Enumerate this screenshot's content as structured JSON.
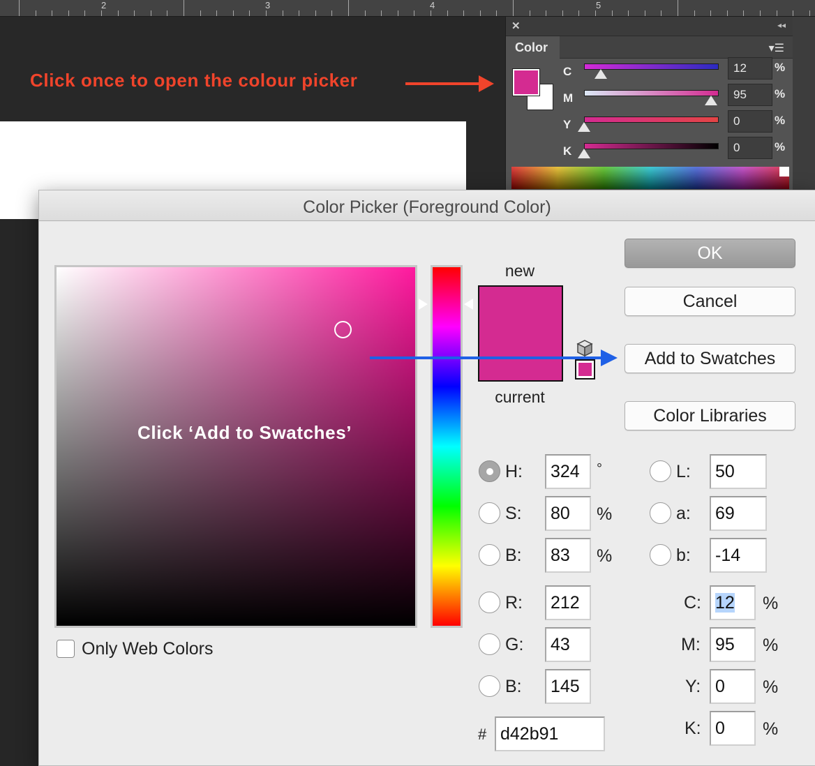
{
  "ruler": {
    "numbers": [
      "2",
      "3",
      "4",
      "5"
    ]
  },
  "annotations": {
    "top": "Click once to open the colour picker",
    "mid": "Click ‘Add to Swatches’"
  },
  "colors": {
    "foreground": "#d42b91",
    "annotation_red": "#f0442b",
    "annotation_blue": "#1f60e6"
  },
  "color_panel": {
    "close_icon": "close-icon",
    "collapse_icon": "double-chevron-left-icon",
    "tab_label": "Color",
    "menu_icon": "panel-menu-icon",
    "sliders": [
      {
        "letter": "C",
        "value": "12",
        "unit": "%"
      },
      {
        "letter": "M",
        "value": "95",
        "unit": "%"
      },
      {
        "letter": "Y",
        "value": "0",
        "unit": "%"
      },
      {
        "letter": "K",
        "value": "0",
        "unit": "%"
      }
    ]
  },
  "dialog": {
    "title": "Color Picker (Foreground Color)",
    "new_label": "new",
    "current_label": "current",
    "buttons": {
      "ok": "OK",
      "cancel": "Cancel",
      "add_to_swatches": "Add to Swatches",
      "color_libraries": "Color Libraries"
    },
    "only_web_colors": "Only Web Colors",
    "hsb": [
      {
        "label": "H:",
        "value": "324",
        "unit": "°",
        "checked": true
      },
      {
        "label": "S:",
        "value": "80",
        "unit": "%",
        "checked": false
      },
      {
        "label": "B:",
        "value": "83",
        "unit": "%",
        "checked": false
      }
    ],
    "rgb": [
      {
        "label": "R:",
        "value": "212"
      },
      {
        "label": "G:",
        "value": "43"
      },
      {
        "label": "B:",
        "value": "145"
      }
    ],
    "lab": [
      {
        "label": "L:",
        "value": "50"
      },
      {
        "label": "a:",
        "value": "69"
      },
      {
        "label": "b:",
        "value": "-14"
      }
    ],
    "cmyk": [
      {
        "label": "C:",
        "value": "12",
        "unit": "%"
      },
      {
        "label": "M:",
        "value": "95",
        "unit": "%"
      },
      {
        "label": "Y:",
        "value": "0",
        "unit": "%"
      },
      {
        "label": "K:",
        "value": "0",
        "unit": "%"
      }
    ],
    "hex_label": "#",
    "hex_value": "d42b91"
  }
}
